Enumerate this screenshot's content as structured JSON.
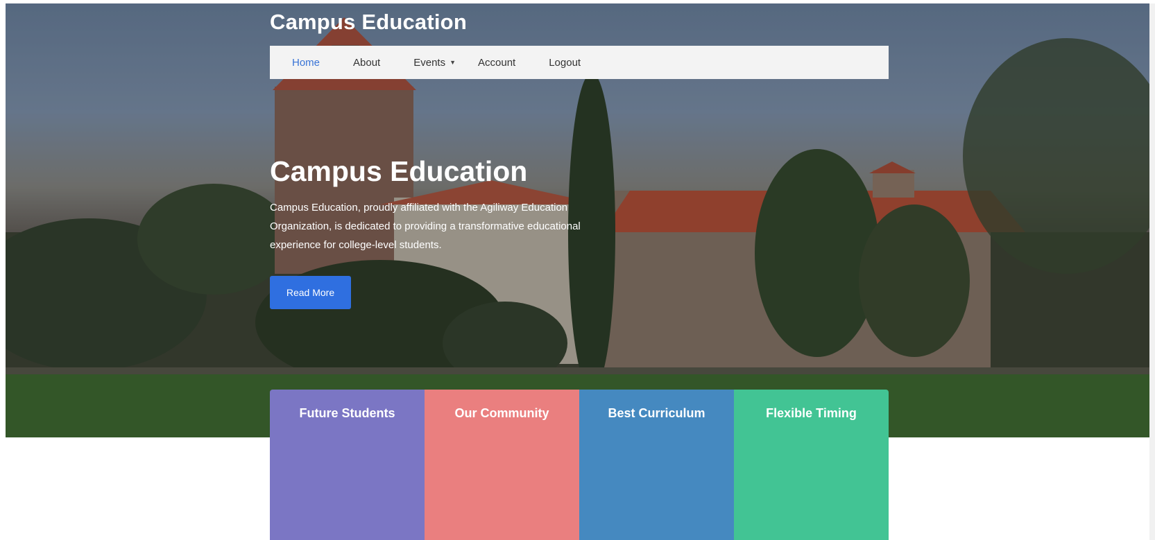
{
  "header": {
    "site_title": "Campus Education"
  },
  "nav": {
    "items": [
      {
        "label": "Home",
        "active": true
      },
      {
        "label": "About",
        "active": false
      },
      {
        "label": "Events",
        "active": false,
        "has_dropdown": true
      },
      {
        "label": "Account",
        "active": false
      },
      {
        "label": "Logout",
        "active": false
      }
    ],
    "dropdown_icon": "caret-down-icon"
  },
  "hero": {
    "heading": "Campus Education",
    "text": "Campus Education, proudly affiliated with the Agiliway Education Organization, is dedicated to providing a transformative educational experience for college-level students.",
    "button_label": "Read More",
    "button_color": "#2f6fe0"
  },
  "cards": [
    {
      "title": "Future Students",
      "color": "#7b76c4"
    },
    {
      "title": "Our Community",
      "color": "#ea7f7f"
    },
    {
      "title": "Best Curriculum",
      "color": "#4589c0"
    },
    {
      "title": "Flexible Timing",
      "color": "#42c494"
    }
  ],
  "colors": {
    "nav_background": "#f3f3f3",
    "nav_active": "#3873d6"
  }
}
